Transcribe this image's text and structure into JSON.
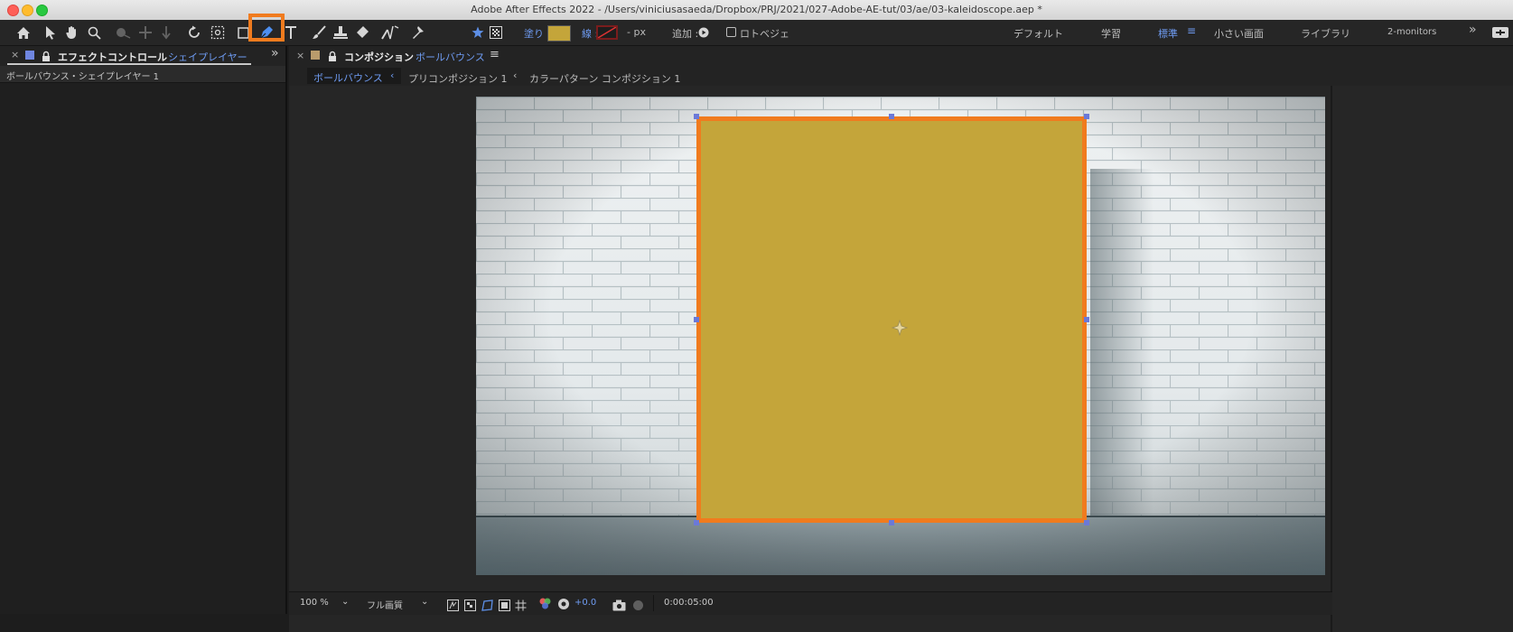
{
  "window": {
    "title": "Adobe After Effects 2022 - /Users/viniciusasaeda/Dropbox/PRJ/2021/027-Adobe-AE-tut/03/ae/03-kaleidoscope.aep *"
  },
  "toolbar": {
    "fill_label": "塗り :",
    "stroke_label": "線 :",
    "stroke_width": "- px",
    "add_label": "追加 :",
    "rotobezier_label": "ロトベジェ",
    "fill_color": "#c4a53a",
    "stroke_color": "#7a1d1d",
    "highlight_color": "#f07b1e"
  },
  "workspaces": {
    "items": [
      "デフォルト",
      "学習",
      "標準",
      "小さい画面",
      "ライブラリ",
      "2-monitors"
    ],
    "active": "標準",
    "overflow": "»"
  },
  "effect_panel": {
    "close": "×",
    "title": "エフェクトコントロール",
    "layer": "シェイプレイヤー 1",
    "overflow": "»",
    "subtitle": "ボールバウンス・シェイプレイヤー 1"
  },
  "comp_panel": {
    "close": "×",
    "title": "コンポジション",
    "comp_name": "ボールバウンス",
    "menu": "≡",
    "breadcrumbs": [
      "ボールバウンス",
      "プリコンポジション 1",
      "カラーパターン コンポジション 1"
    ]
  },
  "viewer_bottom": {
    "zoom": "100 %",
    "resolution": "フル画質",
    "exposure": "+0.0",
    "timecode": "0:00:05:00"
  }
}
